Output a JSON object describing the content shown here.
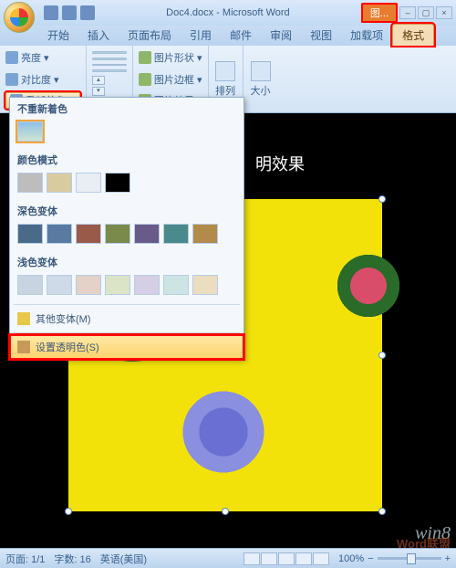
{
  "title": "Doc4.docx - Microsoft Word",
  "context_tab": "图...",
  "tabs": [
    "开始",
    "插入",
    "页面布局",
    "引用",
    "邮件",
    "审阅",
    "视图",
    "加载项",
    "格式"
  ],
  "active_tab_index": 8,
  "ribbon": {
    "adjust": {
      "brightness_label": "亮度 ▾",
      "contrast_label": "对比度 ▾",
      "recolor_label": "重新着色"
    },
    "picstyle": {
      "shape_label": "图片形状 ▾",
      "border_label": "图片边框 ▾",
      "effects_label": "图片效果 ▾"
    },
    "arrange_label": "排列",
    "size_label": "大小"
  },
  "dropdown": {
    "sect_none": "不重新着色",
    "sect_mode": "颜色模式",
    "sect_dark": "深色变体",
    "sect_light": "浅色变体",
    "more_variants": "其他变体(M)",
    "set_transparent": "设置透明色(S)"
  },
  "doc_text": "明效果",
  "status": {
    "page": "页面: 1/1",
    "words": "字数: 16",
    "lang": "英语(美国)",
    "zoom": "100%"
  },
  "watermark1": "win8",
  "watermark2": "Word联盟"
}
